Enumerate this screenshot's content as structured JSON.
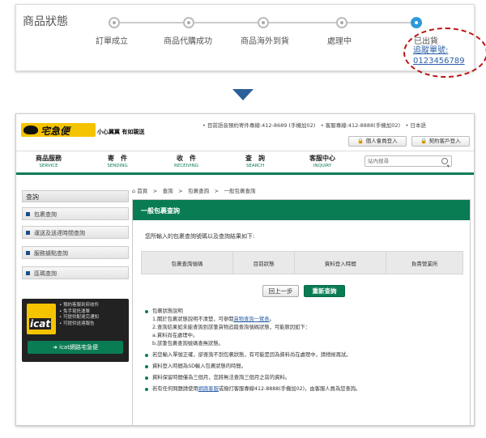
{
  "status": {
    "title": "商品狀態",
    "steps": [
      "訂單成立",
      "商品代購成功",
      "商品海外到貨",
      "處理中"
    ],
    "current_step": "已出貨",
    "tracking_label": "追蹤單號:",
    "tracking_number": "0123456789"
  },
  "site": {
    "logo": "宅急便",
    "tagline": "小心翼翼 有如親送",
    "top_links": "• 目前語音預約寄件專線:412-8689 (手機加02)　• 客服專線:412-8888(手機加02)　• 日本語",
    "member_login": "個人會員登入",
    "contract_login": "契約客戶登入",
    "nav": [
      {
        "zh": "商品服務",
        "en": "SERVICE"
      },
      {
        "zh": "寄　件",
        "en": "SENDING"
      },
      {
        "zh": "收　件",
        "en": "RECEIVING"
      },
      {
        "zh": "查　詢",
        "en": "SEARCH"
      },
      {
        "zh": "客服中心",
        "en": "INQUIRY"
      }
    ],
    "search_placeholder": "站內搜尋",
    "sidebar": {
      "title": "查詢",
      "items": [
        "包裹查詢",
        "運送及送達時間查詢",
        "服務據點查詢",
        "區碼查詢"
      ]
    },
    "icat": {
      "logo": "icat",
      "features": [
        "• 預約客服到府收件",
        "• 免手寫託運單",
        "• 可提供配達完通知",
        "• 可提供送達報告"
      ],
      "button": "icat網路宅急便"
    },
    "breadcrumb": "首頁　>　查詢　>　包裹查詢　>　一般包裹查詢",
    "panel": {
      "title": "一般包裹查詢",
      "intro": "您所輸入的包裹查詢號碼以及查詢結果如下:",
      "columns": [
        "包裹查詢號碼",
        "目前狀態",
        "資料登入時間",
        "負責營業所"
      ],
      "prev_button": "回上一步",
      "requery_button": "重新查詢",
      "notes": {
        "n1_title": "包裹狀態說明",
        "n1_l1a": "1.關於包裹狀態說明不清楚，可參閱",
        "n1_l1_link": "貨物查詢一覽表",
        "n1_l1b": "。",
        "n1_l2": "2.查詢結果如未能查詢到該筆貨物追蹤查詢號碼狀態，可能原因如下：",
        "n1_l3": "a.資料尚在處理中。",
        "n1_l4": "b.該筆包裹查詢號碼查無狀態。",
        "n2": "若您輸入單號正確，卻查詢不到包裹狀態，有可能是因為資料尚在處理中，請稍候再試。",
        "n3": "資料登入時間為SD輸入包裹狀態的時間。",
        "n4": "資料保留時間僅為三個月，您將無法查詢三個月之前的資料。",
        "n5a": "若有任何問題請使用",
        "n5_link": "網路客服",
        "n5b": "或撥打客服專線412-8888(手機加02)，由客服人員為您查詢。"
      }
    }
  }
}
